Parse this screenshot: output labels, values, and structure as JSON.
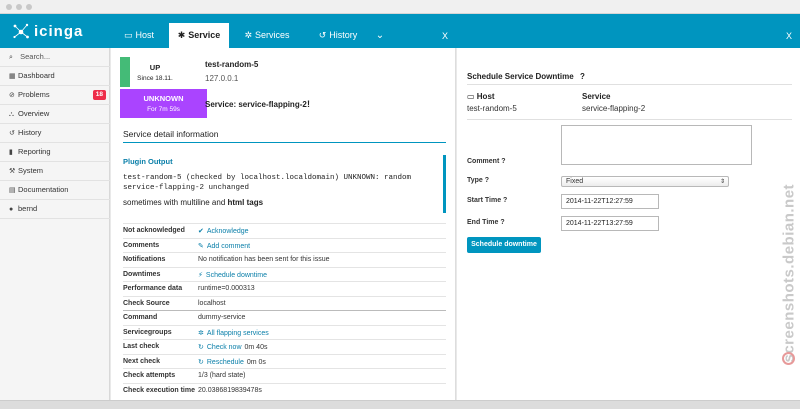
{
  "header": {
    "logo_text": "icinga",
    "tabs": [
      {
        "label": "Host",
        "icon": "laptop-icon"
      },
      {
        "label": "Service",
        "icon": "gear-icon"
      },
      {
        "label": "Services",
        "icon": "gears-icon"
      },
      {
        "label": "History",
        "icon": "history-icon"
      }
    ],
    "close_left": "X",
    "close_right": "X"
  },
  "sidebar": {
    "search_placeholder": "Search...",
    "items": [
      {
        "label": "Dashboard",
        "icon": "grid-icon"
      },
      {
        "label": "Problems",
        "icon": "problem-icon",
        "badge": "18"
      },
      {
        "label": "Overview",
        "icon": "sitemap-icon"
      },
      {
        "label": "History",
        "icon": "history-icon"
      },
      {
        "label": "Reporting",
        "icon": "chart-icon"
      },
      {
        "label": "System",
        "icon": "wrench-icon"
      },
      {
        "label": "Documentation",
        "icon": "book-icon"
      },
      {
        "label": "bernd",
        "icon": "user-icon"
      }
    ]
  },
  "host_state": {
    "label": "UP",
    "since": "Since 18.11.",
    "color": "#44bb77"
  },
  "host": {
    "name": "test-random-5",
    "address": "127.0.0.1"
  },
  "service_state": {
    "label": "UNKNOWN",
    "duration": "For 7m 59s",
    "color": "#aa44ff"
  },
  "service": {
    "label": "Service: service-flapping-2",
    "flag": "!"
  },
  "detail": {
    "title": "Service detail information",
    "plugin_output_title": "Plugin Output",
    "output_line1": "test-random-5 (checked by localhost.localdomain) UNKNOWN: random",
    "output_line2": "service-flapping-2 unchanged",
    "output_text": "sometimes with multiline and ",
    "output_bold": "html tags"
  },
  "rows": [
    {
      "key": "Not acknowledged",
      "icon": "check-icon",
      "value": "Acknowledge",
      "link": true
    },
    {
      "key": "Comments",
      "icon": "comment-icon",
      "value": "Add comment",
      "link": true
    },
    {
      "key": "Notifications",
      "icon": "",
      "value": "No notification has been sent for this issue",
      "link": false
    },
    {
      "key": "Downtimes",
      "icon": "plug-icon",
      "value": "Schedule downtime",
      "link": true
    },
    {
      "key": "Performance data",
      "icon": "",
      "value": "runtime=0.000313",
      "link": false
    },
    {
      "key": "Check Source",
      "icon": "",
      "value": "localhost",
      "link": false
    },
    {
      "key": "Command",
      "icon": "",
      "value": "dummy-service",
      "link": false
    },
    {
      "key": "Servicegroups",
      "icon": "gears-icon",
      "value": "All flapping services",
      "link": true
    },
    {
      "key": "Last check",
      "icon": "refresh-icon",
      "value": "Check now",
      "link": true,
      "extra": "0m 40s"
    },
    {
      "key": "Next check",
      "icon": "refresh-icon",
      "value": "Reschedule",
      "link": true,
      "extra": "0m 0s"
    },
    {
      "key": "Check attempts",
      "icon": "",
      "value": "1/3 (hard state)",
      "link": false
    },
    {
      "key": "Check execution time",
      "icon": "",
      "value": "20.0386819839478s",
      "link": false
    }
  ],
  "downtime": {
    "title": "Schedule Service Downtime",
    "help": "?",
    "host_label": "Host",
    "host_value": "test-random-5",
    "service_label": "Service",
    "service_value": "service-flapping-2",
    "comment_label": "Comment ?",
    "type_label": "Type ?",
    "type_value": "Fixed",
    "start_label": "Start Time ?",
    "start_value": "2014-11-22T12:27:59",
    "end_label": "End Time ?",
    "end_value": "2014-11-22T13:27:59",
    "submit_label": "Schedule downtime"
  },
  "watermark": "screenshots.debian.net",
  "colors": {
    "accent": "#0095bf",
    "up": "#44bb77",
    "unknown": "#aa44ff",
    "badge": "#ee2d4a"
  }
}
